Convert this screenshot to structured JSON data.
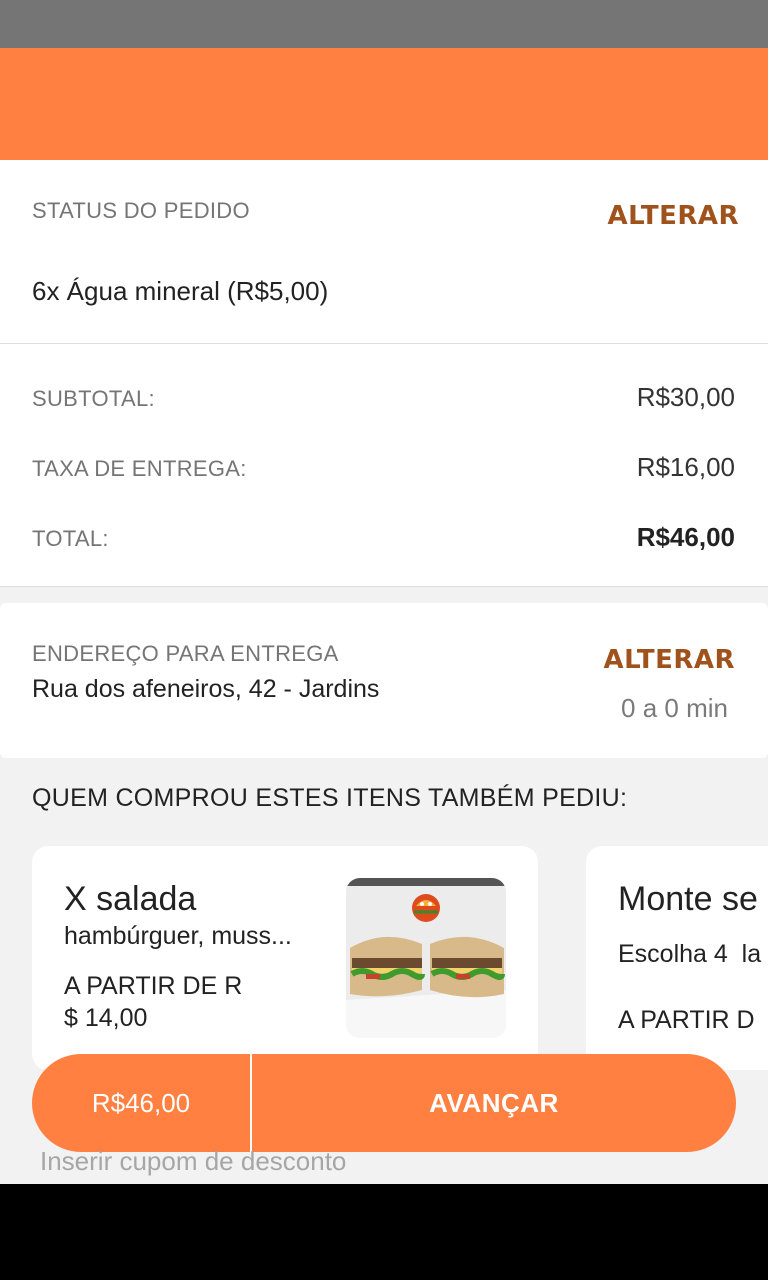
{
  "order": {
    "section_label": "STATUS DO PEDIDO",
    "alter_label": "ALTERAR",
    "item_line": "6x Água mineral (R$5,00)"
  },
  "totals": {
    "subtotal_label": "SUBTOTAL:",
    "subtotal_value": "R$30,00",
    "fee_label": "TAXA DE ENTREGA:",
    "fee_value": "R$16,00",
    "total_label": "TOTAL:",
    "total_value": "R$46,00"
  },
  "address": {
    "section_label": "ENDEREÇO PARA ENTREGA",
    "value": "Rua dos afeneiros, 42 - Jardins",
    "alter_label": "ALTERAR",
    "eta": "0 a 0 min"
  },
  "suggestions": {
    "title": "QUEM COMPROU ESTES ITENS TAMBÉM PEDIU:",
    "items": [
      {
        "name": "X salada",
        "description": "hambúrguer, muss...",
        "price_line1": "A PARTIR DE R",
        "price_line2": "$ 14,00"
      },
      {
        "name": "Monte se",
        "description": "Escolha 4  la",
        "price_line1": "A PARTIR D"
      }
    ]
  },
  "cta": {
    "price": "R$46,00",
    "next_label": "AVANÇAR"
  },
  "coupon": {
    "placeholder": "Inserir cupom de desconto"
  },
  "colors": {
    "accent": "#ff8040",
    "alter_text": "#a0521c"
  }
}
